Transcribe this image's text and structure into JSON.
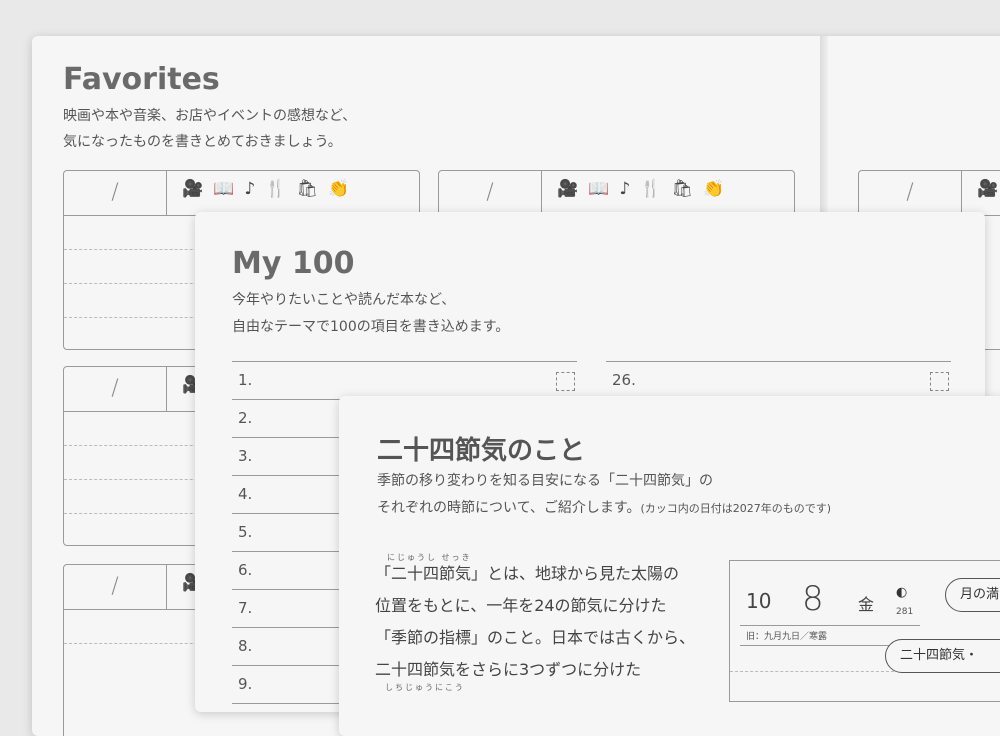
{
  "favorites": {
    "title": "Favorites",
    "desc1": "映画や本や音楽、お店やイベントの感想など、",
    "desc2": "気になったものを書きとめておきましょう。",
    "date_slash": "/",
    "icons": [
      "movie-camera-icon",
      "book-icon",
      "music-note-icon",
      "fork-knife-icon",
      "shopping-bag-icon",
      "clapping-hands-icon"
    ],
    "icon_glyphs": [
      "🎥",
      "📖",
      "♪",
      "🍴",
      "🛍",
      "👏"
    ]
  },
  "my100": {
    "title": "My 100",
    "desc1": "今年やりたいことや読んだ本など、",
    "desc2": "自由なテーマで100の項目を書き込めます。",
    "items_left": [
      "1.",
      "2.",
      "3.",
      "4.",
      "5.",
      "6.",
      "7.",
      "8.",
      "9."
    ],
    "item_right": "26."
  },
  "sekki": {
    "title": "二十四節気のこと",
    "desc1": "季節の移り変わりを知る目安になる「二十四節気」の",
    "desc2": "それぞれの時節について、ご紹介します。",
    "desc2_small": "(カッコ内の日付は2027年のものです)",
    "ruby1": "にじゅうし せっき",
    "body1": "「二十四節気」とは、地球から見た太陽の",
    "body2": "位置をもとに、一年を24の節気に分けた",
    "body3": "「季節の指標」のこと。日本では古くから、",
    "body4": "二十四節気をさらに3つずつに分けた",
    "ruby2": "しちじゅうにこう",
    "cal_month": "10",
    "cal_day": "8",
    "cal_weekday": "金",
    "cal_moon_num": "281",
    "cal_old": "旧：九月九日／寒露",
    "bubble1": "月の満",
    "bubble2": "二十四節気・"
  }
}
